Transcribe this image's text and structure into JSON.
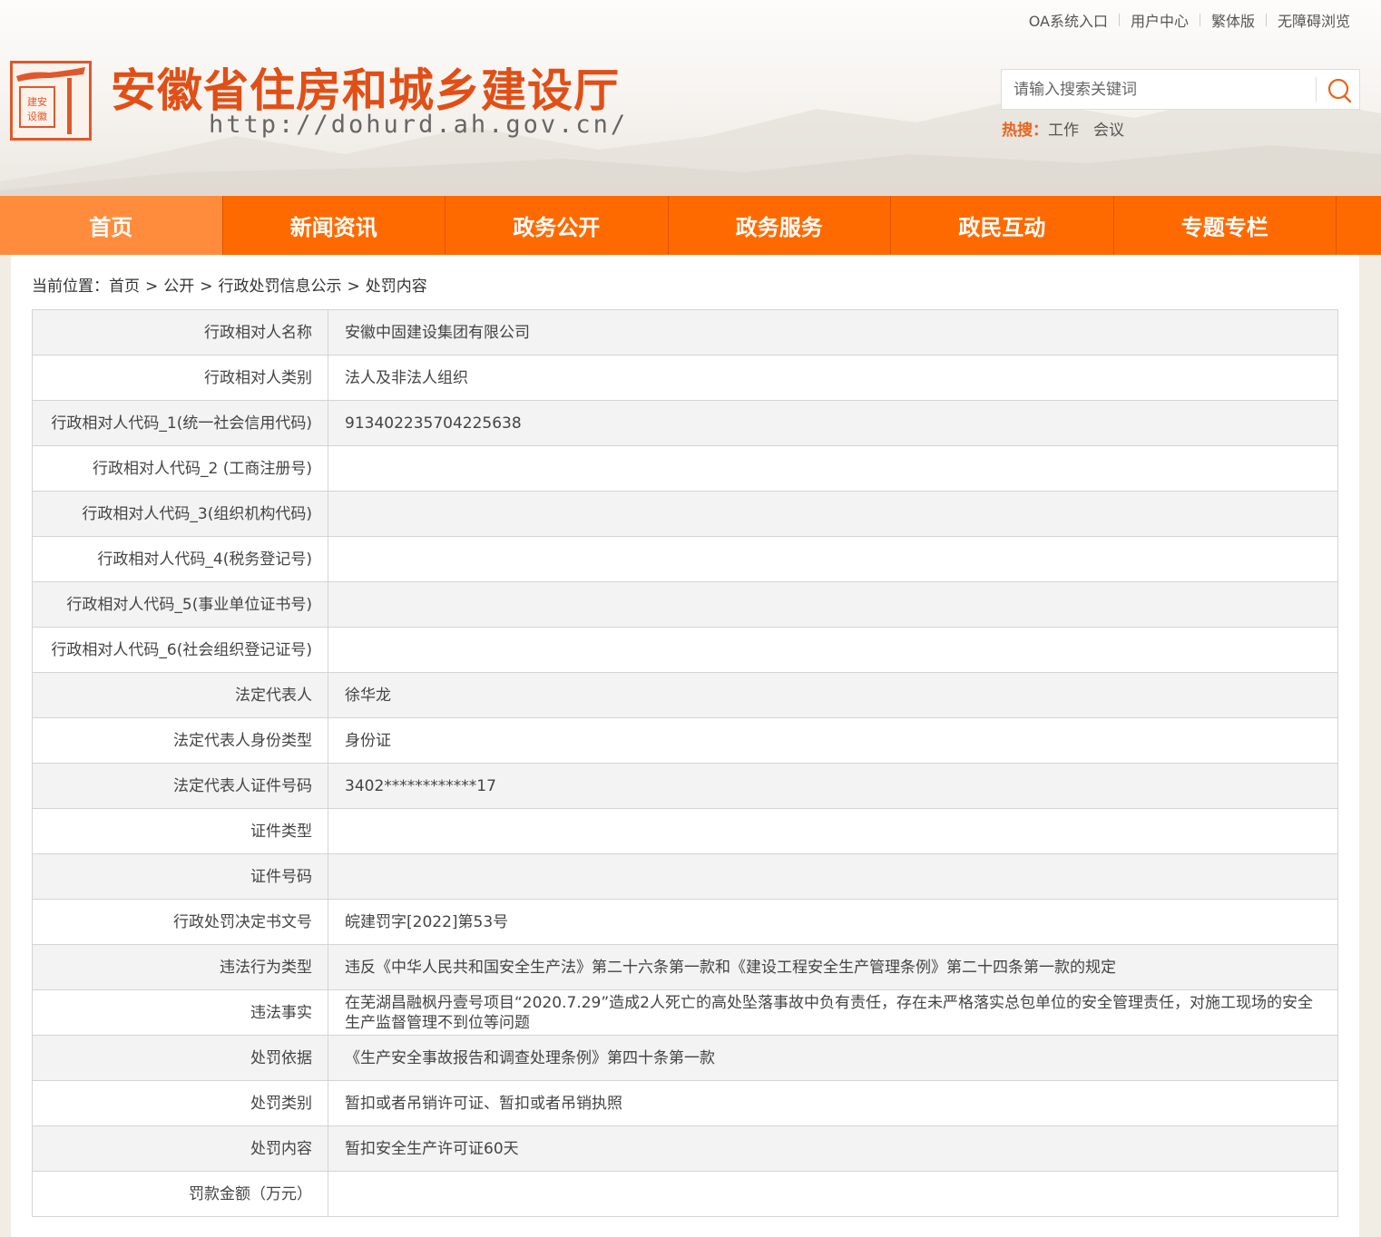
{
  "top_links": [
    "OA系统入口",
    "用户中心",
    "繁体版",
    "无障碍浏览"
  ],
  "site": {
    "title": "安徽省住房和城乡建设厅",
    "url": "http://dohurd.ah.gov.cn/"
  },
  "search": {
    "placeholder": "请输入搜索关键词",
    "hot_label": "热搜：",
    "hot_items": [
      "工作",
      "会议"
    ]
  },
  "nav": [
    "首页",
    "新闻资讯",
    "政务公开",
    "政务服务",
    "政民互动",
    "专题专栏"
  ],
  "breadcrumb": {
    "prefix": "当前位置：",
    "items": [
      "首页",
      "公开",
      "行政处罚信息公示",
      "处罚内容"
    ],
    "separator": ">"
  },
  "rows": [
    {
      "label": "行政相对人名称",
      "value": "安徽中固建设集团有限公司"
    },
    {
      "label": "行政相对人类别",
      "value": "法人及非法人组织"
    },
    {
      "label": "行政相对人代码_1(统一社会信用代码)",
      "value": "913402235704225638"
    },
    {
      "label": "行政相对人代码_2 (工商注册号)",
      "value": ""
    },
    {
      "label": "行政相对人代码_3(组织机构代码)",
      "value": ""
    },
    {
      "label": "行政相对人代码_4(税务登记号)",
      "value": ""
    },
    {
      "label": "行政相对人代码_5(事业单位证书号)",
      "value": ""
    },
    {
      "label": "行政相对人代码_6(社会组织登记证号)",
      "value": ""
    },
    {
      "label": "法定代表人",
      "value": "徐华龙"
    },
    {
      "label": "法定代表人身份类型",
      "value": "身份证"
    },
    {
      "label": "法定代表人证件号码",
      "value": "3402************17"
    },
    {
      "label": "证件类型",
      "value": ""
    },
    {
      "label": "证件号码",
      "value": ""
    },
    {
      "label": "行政处罚决定书文号",
      "value": "皖建罚字[2022]第53号"
    },
    {
      "label": "违法行为类型",
      "value": "违反《中华人民共和国安全生产法》第二十六条第一款和《建设工程安全生产管理条例》第二十四条第一款的规定"
    },
    {
      "label": "违法事实",
      "value": "在芜湖昌融枫丹壹号项目“2020.7.29”造成2人死亡的高处坠落事故中负有责任，存在未严格落实总包单位的安全管理责任，对施工现场的安全生产监督管理不到位等问题"
    },
    {
      "label": "处罚依据",
      "value": "《生产安全事故报告和调查处理条例》第四十条第一款"
    },
    {
      "label": "处罚类别",
      "value": "暂扣或者吊销许可证、暂扣或者吊销执照"
    },
    {
      "label": "处罚内容",
      "value": "暂扣安全生产许可证60天"
    },
    {
      "label": "罚款金额（万元）",
      "value": ""
    }
  ],
  "colors": {
    "brand_orange": "#ff6a00",
    "nav_active": "#ff8c3c",
    "title_red": "#e14f16"
  },
  "icons": [
    "seal-logo-icon",
    "search-icon"
  ]
}
